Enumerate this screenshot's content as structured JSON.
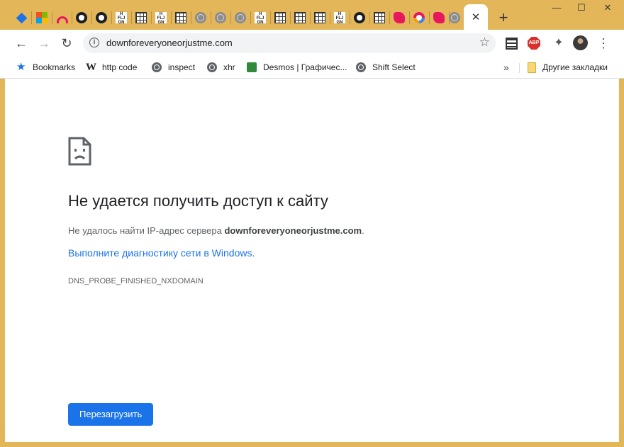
{
  "window": {
    "controls": {
      "minimize": "—",
      "maximize": "☐",
      "close": "✕"
    }
  },
  "tabs": {
    "favicons": [
      "diamond-icon",
      "microsoft-icon",
      "arc-icon",
      "github-icon",
      "github-icon",
      "text-badge-icon",
      "sheet-icon",
      "text-badge-icon",
      "sheet-icon",
      "globe-icon",
      "globe-icon",
      "globe-icon",
      "text-badge-icon",
      "sheet-icon",
      "sheet-icon",
      "text-badge-icon",
      "github-icon",
      "sheet-icon",
      "pink-icon",
      "ring-icon",
      "pink-icon",
      "globe-icon"
    ],
    "badge_text": "H\nFLJ\nGNCZA",
    "active_close": "✕",
    "new_tab": "+"
  },
  "toolbar": {
    "back": "←",
    "forward": "→",
    "reload": "↻",
    "url": "downforeveryoneorjustme.com",
    "info": "i",
    "star": "☆",
    "extension_abp": "ABP",
    "menu": "⋮",
    "puzzle": "✦"
  },
  "bookmarks": {
    "items": [
      {
        "label": "Bookmarks",
        "icon": "star-icon"
      },
      {
        "label": "http code",
        "icon": "wikipedia-icon"
      },
      {
        "label": "inspect",
        "icon": "globe-icon"
      },
      {
        "label": "xhr",
        "icon": "globe-icon"
      },
      {
        "label": "Desmos | Графичес...",
        "icon": "desmos-icon"
      },
      {
        "label": "Shift Select",
        "icon": "globe-icon"
      }
    ],
    "overflow": "»",
    "other": "Другие закладки"
  },
  "page": {
    "title": "Не удается получить доступ к сайту",
    "description_prefix": "Не удалось найти IP-адрес сервера ",
    "description_domain": "downforeveryoneorjustme.com",
    "description_suffix": ".",
    "diagnostics_link": "Выполните диагностику сети в Windows.",
    "error_code": "DNS_PROBE_FINISHED_NXDOMAIN",
    "reload_button": "Перезагрузить"
  }
}
